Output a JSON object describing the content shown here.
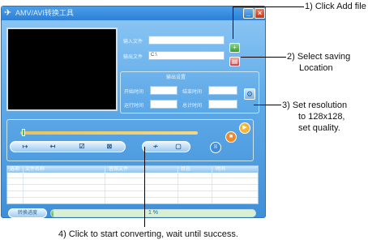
{
  "window": {
    "title": "AMV/AVI转换工具",
    "icon": "film-icon",
    "minimize": "_",
    "close": "×"
  },
  "inputs": {
    "input_label": "输入文件",
    "input_value": "",
    "output_label": "输出文件",
    "output_value": "C:\\"
  },
  "settings": {
    "title": "输出设置",
    "start_label": "开始时间",
    "end_label": "结束时间",
    "run_label": "运行时间",
    "total_label": "总计时间",
    "button_icon": "settings-icon"
  },
  "controls": {
    "mark_in": "↦",
    "mark_out": "↤",
    "check": "☑",
    "cancel": "⊠",
    "convert": "≁",
    "stop": "▢",
    "play": "▶",
    "pause": "■",
    "info": "II"
  },
  "table": {
    "headers": [
      "选项",
      "文件名称",
      "音频文件",
      "状态",
      "时间"
    ]
  },
  "status": {
    "button_label": "转换进度",
    "progress_percent": 1,
    "progress_text": "1 %"
  },
  "callouts": {
    "c1": "1) Click Add file",
    "c2a": "2) Select saving",
    "c2b": "Location",
    "c3a": "3) Set resolution",
    "c3b": "to 128x128,",
    "c3c": "set quality.",
    "c4": "4) Click to start converting, wait until success."
  }
}
